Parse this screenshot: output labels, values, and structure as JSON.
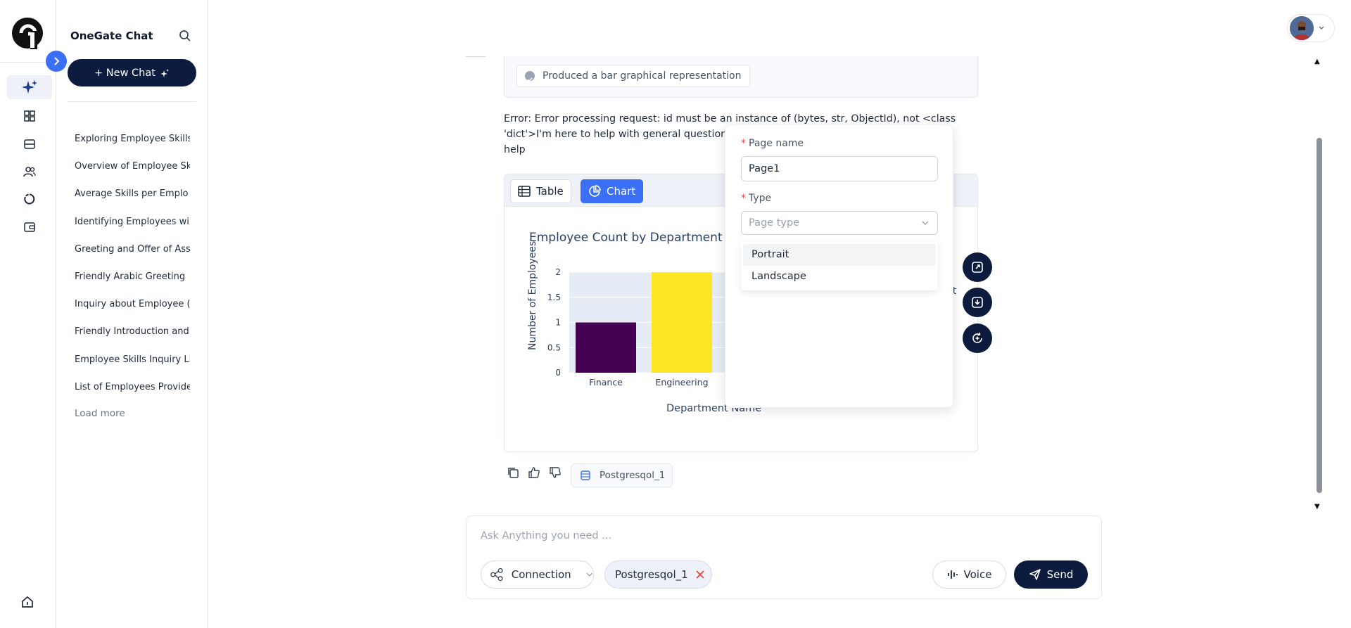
{
  "sidebar": {
    "app_title": "OneGate Chat",
    "new_chat_label": "+ New Chat",
    "history": [
      "Exploring Employee Skills",
      "Overview of Employee Sk",
      "Average Skills per Emplo",
      "Identifying Employees wi",
      "Greeting and Offer of Ass",
      "Friendly Arabic Greeting",
      "Inquiry about Employee (",
      "Friendly Introduction and",
      "Employee Skills Inquiry Li",
      "List of Employees Provide"
    ],
    "load_more": "Load more",
    "rail_icons": [
      "ai-sparkle-icon",
      "dashboard-icon",
      "database-icon",
      "users-icon",
      "analytics-icon",
      "wallet-icon"
    ]
  },
  "conversation": {
    "step": "Produced a bar graphical representation",
    "message": "Error: Error processing request: id must be an instance of (bytes, str, ObjectId), not <class 'dict'>I'm here to help with general questions, assignments in departments. If you need help",
    "tabs": {
      "table": "Table",
      "chart": "Chart"
    },
    "legend_fragment": "nt",
    "db_tag": "Postgresqol_1"
  },
  "chart_data": {
    "type": "bar",
    "title": "Employee Count by Department",
    "xlabel": "Department Name",
    "ylabel": "Number of Employees",
    "categories": [
      "Finance",
      "Engineering"
    ],
    "values": [
      1,
      2
    ],
    "colors": [
      "#440154",
      "#fde725"
    ],
    "yticks": [
      "0",
      "0.5",
      "1",
      "1.5",
      "2"
    ],
    "ylim": [
      0,
      2
    ]
  },
  "modal": {
    "page_name_label": "Page name",
    "page_name_value": "Page1",
    "type_label": "Type",
    "type_placeholder": "Page type",
    "options": [
      "Portrait",
      "Landscape"
    ]
  },
  "input": {
    "placeholder": "Ask Anything you need ...",
    "connection_label": "Connection",
    "connection_tag": "Postgresqol_1",
    "voice_label": "Voice",
    "send_label": "Send"
  }
}
